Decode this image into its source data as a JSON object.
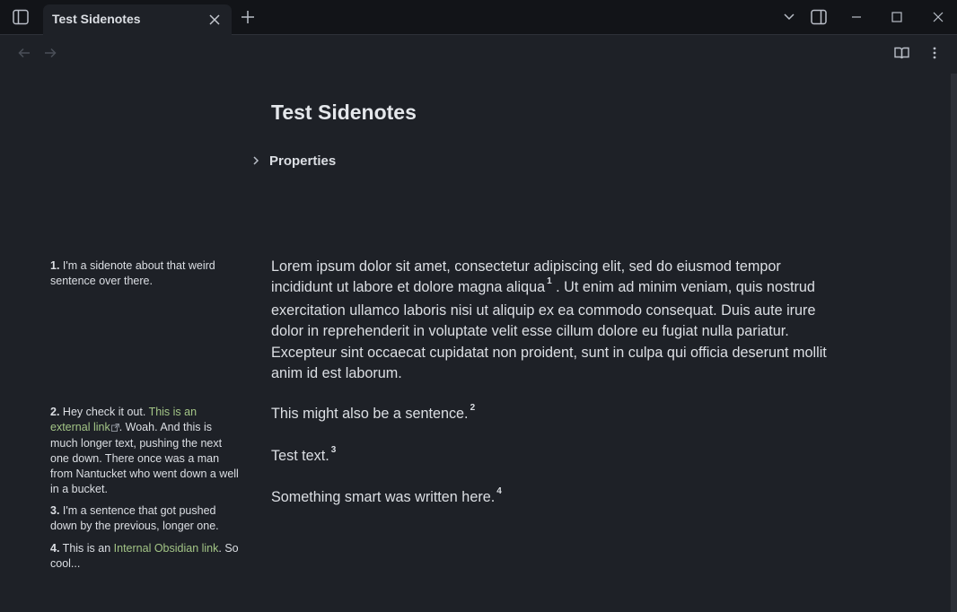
{
  "tab": {
    "title": "Test Sidenotes"
  },
  "note": {
    "title": "Test Sidenotes",
    "properties_label": "Properties",
    "paragraph1_a": "Lorem ipsum dolor sit amet, consectetur adipiscing elit, sed do eiusmod tempor incididunt ut labore et dolore magna aliqua",
    "ref1": "1",
    "paragraph1_b": " . Ut enim ad minim veniam, quis nostrud exercitation ullamco laboris nisi ut aliquip ex ea commodo consequat. Duis aute irure dolor in reprehenderit in voluptate velit esse cillum dolore eu fugiat nulla pariatur. Excepteur sint occaecat cupidatat non proident, sunt in culpa qui officia deserunt mollit anim id est laborum.",
    "paragraph2": "This might also be a sentence.",
    "ref2": "2",
    "paragraph3": "Test text.",
    "ref3": "3",
    "paragraph4": "Something smart was written here.",
    "ref4": "4"
  },
  "sidenotes": {
    "s1_num": "1.",
    "s1_text": " I'm a sidenote about that weird sentence over there.",
    "s2_num": "2.",
    "s2_text_a": " Hey check it out. ",
    "s2_link": "This is an external link",
    "s2_text_b": ". Woah. And this is much longer text, pushing the next one down. There once was a man from Nantucket who went down a well in a bucket.",
    "s3_num": "3.",
    "s3_text": " I'm a sentence that got pushed down by the previous, longer one.",
    "s4_num": "4.",
    "s4_text_a": " This is an ",
    "s4_link": "Internal Obsidian link",
    "s4_text_b": ". So cool..."
  },
  "colors": {
    "background": "#1e2127",
    "titlebar": "#121418",
    "link": "#a3c586",
    "text": "#dcdfe4"
  },
  "icons": {
    "sidebar_toggle": "sidebar-toggle-icon",
    "tab_close": "close-icon",
    "new_tab": "plus-icon",
    "tab_list": "chevron-down-icon",
    "right_sidebar": "right-sidebar-icon",
    "minimize": "minimize-icon",
    "maximize": "maximize-icon",
    "close_window": "close-icon",
    "back": "arrow-left-icon",
    "forward": "arrow-right-icon",
    "reading_view": "book-open-icon",
    "more": "more-vertical-icon"
  }
}
